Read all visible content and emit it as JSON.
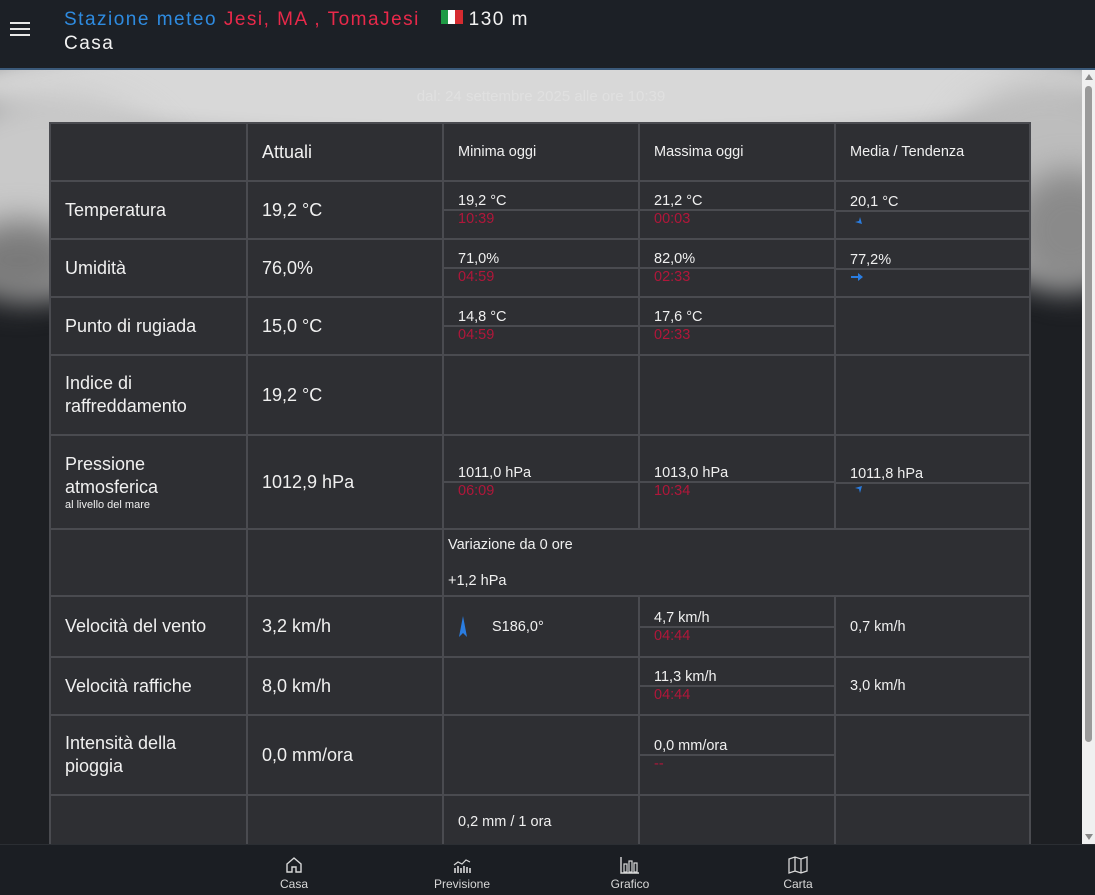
{
  "header": {
    "station_label": "Stazione meteo",
    "location": "Jesi, MA , TomaJesi",
    "altitude": "130 m",
    "subtitle": "Casa"
  },
  "updated": "dal: 24 settembre 2025 alle ore 10:39",
  "table": {
    "headers": [
      "Attuali",
      "Minima oggi",
      "Massima oggi",
      "Media / Tendenza"
    ],
    "rows": {
      "temperature": {
        "label": "Temperatura",
        "current": "19,2 °C",
        "min": "19,2 °C",
        "min_time": "10:39",
        "max": "21,2 °C",
        "max_time": "00:03",
        "avg": "20,1 °C",
        "trend": "down-right"
      },
      "humidity": {
        "label": "Umidità",
        "current": "76,0%",
        "min": "71,0%",
        "min_time": "04:59",
        "max": "82,0%",
        "max_time": "02:33",
        "avg": "77,2%",
        "trend": "right"
      },
      "dewpoint": {
        "label": "Punto di rugiada",
        "current": "15,0 °C",
        "min": "14,8 °C",
        "min_time": "04:59",
        "max": "17,6 °C",
        "max_time": "02:33"
      },
      "windchill": {
        "label": "Indice di raffreddamento",
        "current": "19,2 °C"
      },
      "pressure": {
        "label": "Pressione atmosferica",
        "sublabel": "al livello del mare",
        "current": "1012,9 hPa",
        "min": "1011,0 hPa",
        "min_time": "06:09",
        "max": "1013,0 hPa",
        "max_time": "10:34",
        "avg": "1011,8 hPa",
        "trend": "up-right"
      },
      "pressure_variation": {
        "label": "Variazione da 0 ore",
        "value": "+1,2 hPa"
      },
      "wind": {
        "label": "Velocità del vento",
        "current": "3,2 km/h",
        "direction": "S186,0°",
        "max": "4,7 km/h",
        "max_time": "04:44",
        "avg": "0,7 km/h"
      },
      "gust": {
        "label": "Velocità raffiche",
        "current": "8,0 km/h",
        "max": "11,3 km/h",
        "max_time": "04:44",
        "avg": "3,0 km/h"
      },
      "rain": {
        "label": "Intensità della pioggia",
        "current": "0,0 mm/ora",
        "max": "0,0 mm/ora",
        "max_time": "--"
      },
      "rain_last": {
        "value": "0,2 mm / 1 ora"
      }
    }
  },
  "nav": [
    {
      "label": "Casa",
      "icon": "home-icon"
    },
    {
      "label": "Previsione",
      "icon": "forecast-icon"
    },
    {
      "label": "Grafico",
      "icon": "chart-icon"
    },
    {
      "label": "Carta",
      "icon": "map-icon"
    }
  ],
  "colors": {
    "accent_blue": "#2e8be0",
    "accent_red": "#e8294a",
    "time_red": "#b0173a",
    "arrow_blue": "#2a7de1"
  }
}
